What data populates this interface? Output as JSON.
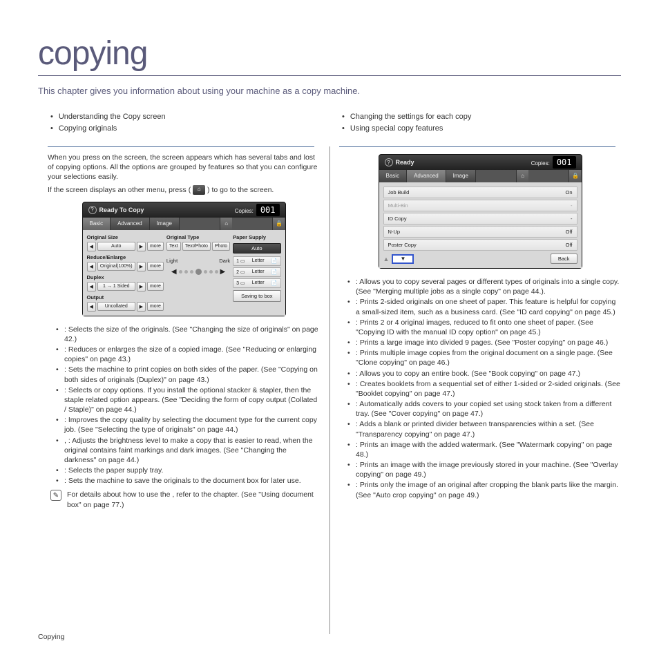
{
  "title": "copying",
  "intro": "This chapter gives you information about using your machine as a copy machine.",
  "toc": {
    "left": [
      "Understanding the Copy screen",
      "Copying originals"
    ],
    "right": [
      "Changing the settings for each copy",
      "Using special copy features"
    ]
  },
  "left_para1": "When you press           on the           screen, the           screen appears which has several tabs and lost of copying options. All the options are grouped by features so that you can configure your selections easily.",
  "left_para2a": "If the screen displays an other menu, press (",
  "left_para2b": ") to go to the           screen.",
  "shot1": {
    "title": "Ready To Copy",
    "copies_label": "Copies:",
    "copies": "001",
    "tabs": [
      "Basic",
      "Advanced",
      "Image"
    ],
    "orig_size": "Original Size",
    "auto": "Auto",
    "more": "more",
    "reduce": "Reduce/Enlarge",
    "orig100": "Original(100%)",
    "duplex": "Duplex",
    "one_sided": "1 → 1 Sided",
    "output": "Output",
    "uncollated": "Uncollated",
    "orig_type": "Original Type",
    "text": "Text",
    "textphoto": "Text/Photo",
    "photo": "Photo",
    "light": "Light",
    "dark": "Dark",
    "paper_supply": "Paper Supply",
    "auto_btn": "Auto",
    "tray": "Letter",
    "save_box": "Saving to box"
  },
  "left_list": [
    "                     : Selects the size of the originals. (See \"Changing the size of originals\" on page 42.)",
    "                         : Reduces or enlarges the size of a copied image. (See \"Reducing or enlarging copies\" on page 43.)",
    "           : Sets the machine to print copies on both sides of the paper. (See \"Copying on both sides of originals (Duplex)\" on page 43.)",
    "           : Selects                    or                    copy options. If you install the optional stacker & stapler, then the staple related option appears. (See \"Deciding the form of copy output (Collated / Staple)\" on page 44.)",
    "                     : Improves the copy quality by selecting the document type for the current copy job. (See \"Selecting the type of originals\" on page 44.)",
    "       ,       : Adjusts the brightness level to make a copy that is easier to read, when the original contains faint markings and dark images. (See \"Changing the darkness\" on page 44.)",
    "                     : Selects the paper supply tray.",
    "                       : Sets the machine to save the originals to the document box for later use."
  ],
  "note_text": "For details about how to use the                          , refer to the                            chapter. (See \"Using document box\" on page 77.)",
  "shot2": {
    "title": "Ready",
    "copies_label": "Copies:",
    "copies": "001",
    "tabs": [
      "Basic",
      "Advanced",
      "Image"
    ],
    "rows": [
      {
        "label": "Job Build",
        "value": "On"
      },
      {
        "label": "Multi-Bin",
        "value": "-",
        "dim": true
      },
      {
        "label": "ID Copy",
        "value": "-"
      },
      {
        "label": "N-Up",
        "value": "Off"
      },
      {
        "label": "Poster Copy",
        "value": "Off"
      }
    ],
    "back": "Back"
  },
  "right_list": [
    "                  : Allows you to copy several pages or different types of originals into a single copy. (See \"Merging multiple jobs as a single copy\" on page 44.).",
    "              : Prints 2-sided originals on one sheet of paper. This feature is helpful for copying a small-sized item, such as a business card. (See \"ID card copying\" on page 45.)",
    "         : Prints 2 or 4 original images, reduced to fit onto one sheet of paper. (See \"Copying ID with the manual ID copy option\" on page 45.)",
    "                    : Prints a large image into divided 9 pages. (See \"Poster copying\" on page 46.)",
    "                    : Prints multiple image copies from the original document on a single page. (See \"Clone copying\" on page 46.)",
    "                    : Allows you to copy an entire book. (See \"Book copying\" on page 47.)",
    "               : Creates booklets from a sequential set of either 1-sided or 2-sided originals. (See \"Booklet copying\" on page 47.)",
    "           : Automatically adds covers to your copied set using stock taken from a different tray. (See \"Cover copying\" on page 47.)",
    "                         : Adds a blank or printed divider between transparencies within a set. (See \"Transparency copying\" on page 47.)",
    "                  : Prints an image with the added watermark. (See \"Watermark copying\" on page 48.)",
    "             : Prints an image with the image previously stored in your machine. (See \"Overlay copying\" on page 49.)",
    "                : Prints only the image of an original after cropping the blank parts like the margin. (See \"Auto crop copying\" on page 49.)"
  ],
  "footer": "Copying"
}
